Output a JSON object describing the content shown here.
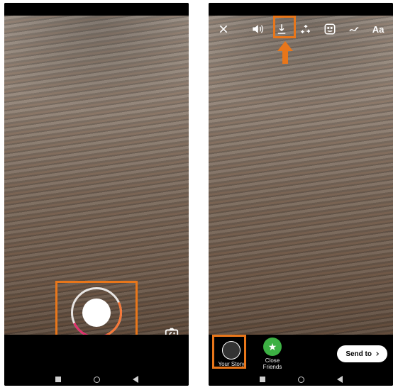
{
  "left": {
    "shutter_name": "shutter",
    "switch_name": "switch-camera"
  },
  "right": {
    "toolbar": {
      "close": "close",
      "sound": "sound",
      "download": "download",
      "effects": "effects",
      "sticker": "sticker",
      "draw": "draw",
      "text_label": "Aa"
    },
    "share": {
      "your_story": "Your Story",
      "close_friends": "Close Friends",
      "send_to": "Send to"
    }
  },
  "highlight_color": "#e8761a"
}
